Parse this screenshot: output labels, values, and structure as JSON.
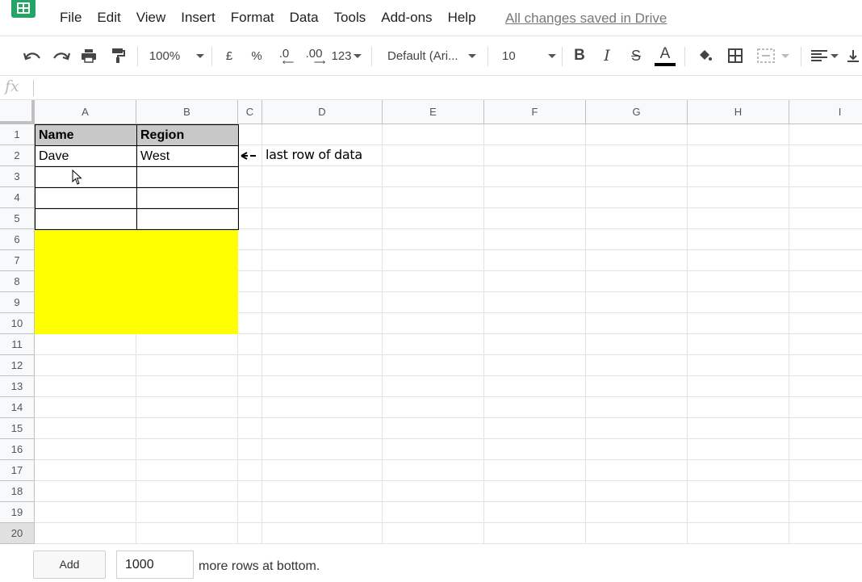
{
  "menu": {
    "items": [
      "File",
      "Edit",
      "View",
      "Insert",
      "Format",
      "Data",
      "Tools",
      "Add-ons",
      "Help"
    ],
    "save_status": "All changes saved in Drive"
  },
  "toolbar": {
    "zoom": "100%",
    "currency": "£",
    "percent": "%",
    "decrease_decimals": ".0",
    "increase_decimals": ".00",
    "more_formats": "123",
    "font_family": "Default (Ari...",
    "font_size": "10",
    "text_color": "#000000"
  },
  "formula_bar": {
    "label": "fx",
    "value": ""
  },
  "sheet": {
    "columns": [
      "A",
      "B",
      "C",
      "D",
      "E",
      "F",
      "G",
      "H",
      "I"
    ],
    "rows": [
      "1",
      "2",
      "3",
      "4",
      "5",
      "6",
      "7",
      "8",
      "9",
      "10",
      "11",
      "12",
      "13",
      "14",
      "15",
      "16",
      "17",
      "18",
      "19",
      "20"
    ],
    "cells": {
      "A1": "Name",
      "B1": "Region",
      "A2": "Dave",
      "B2": "West"
    },
    "annotation": "last row of data",
    "highlight_color": "#ffff00",
    "header_fill": "#c8c8c8"
  },
  "bottom": {
    "add_label": "Add",
    "rows_value": "1000",
    "suffix": "more rows at bottom."
  },
  "colors": {
    "brand": "#23a566"
  }
}
